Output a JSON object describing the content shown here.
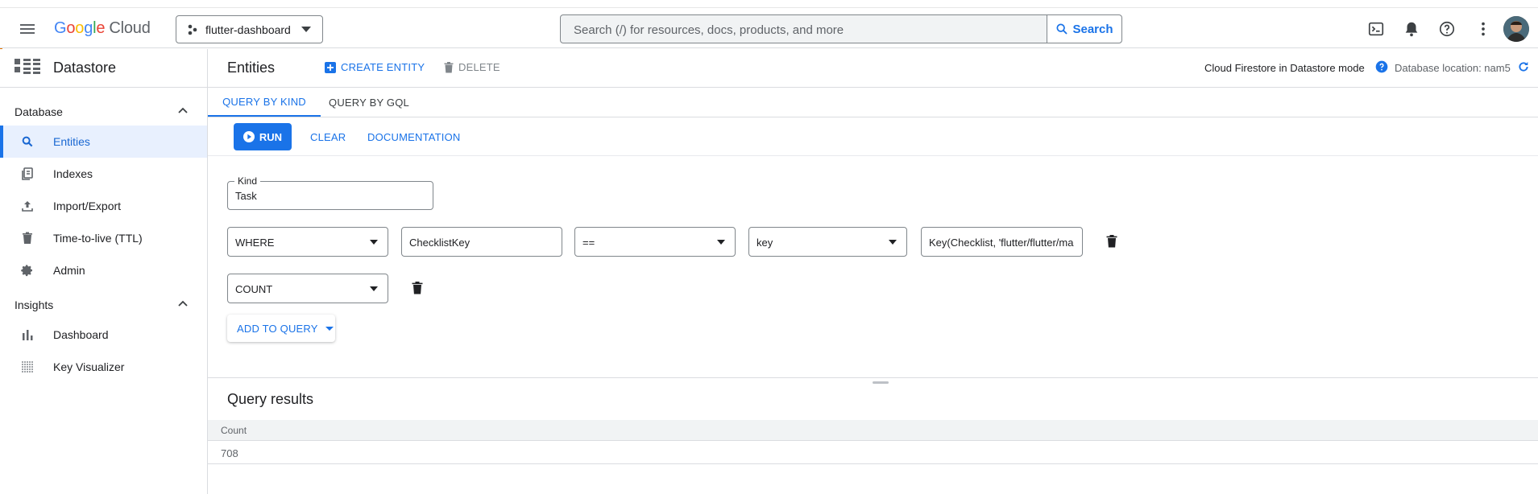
{
  "colors": {
    "accent": "#1a73e8",
    "brand_edge": "#e37400",
    "active_bg": "#e8f0fe"
  },
  "header": {
    "logo": {
      "google": "Google",
      "cloud": "Cloud"
    },
    "project": "flutter-dashboard",
    "search_placeholder": "Search (/) for resources, docs, products, and more",
    "search_button": "Search",
    "icons": [
      "terminal-icon",
      "bell-icon",
      "help-icon",
      "more-vert-icon",
      "avatar"
    ]
  },
  "sidebar": {
    "product": "Datastore",
    "sections": [
      {
        "label": "Database",
        "items": [
          "Entities",
          "Indexes",
          "Import/Export",
          "Time-to-live (TTL)",
          "Admin"
        ]
      },
      {
        "label": "Insights",
        "items": [
          "Dashboard",
          "Key Visualizer"
        ]
      }
    ],
    "active_item": "Entities"
  },
  "toolbar": {
    "title": "Entities",
    "create": "CREATE ENTITY",
    "delete": "DELETE",
    "mode": "Cloud Firestore in Datastore mode",
    "location": "Database location: nam5"
  },
  "tabs": {
    "kind": "QUERY BY KIND",
    "gql": "QUERY BY GQL",
    "active": "QUERY BY KIND"
  },
  "actions": {
    "run": "RUN",
    "clear": "CLEAR",
    "docs": "DOCUMENTATION"
  },
  "query": {
    "kind_label": "Kind",
    "kind_value": "Task",
    "where": {
      "clause": "WHERE",
      "property": "ChecklistKey",
      "operator": "==",
      "type": "key",
      "value": "Key(Checklist, 'flutter/flutter/ma"
    },
    "aggregate": "COUNT",
    "add_button": "ADD TO QUERY"
  },
  "results": {
    "title": "Query results",
    "columns": [
      "Count"
    ],
    "rows": [
      [
        "708"
      ]
    ]
  }
}
